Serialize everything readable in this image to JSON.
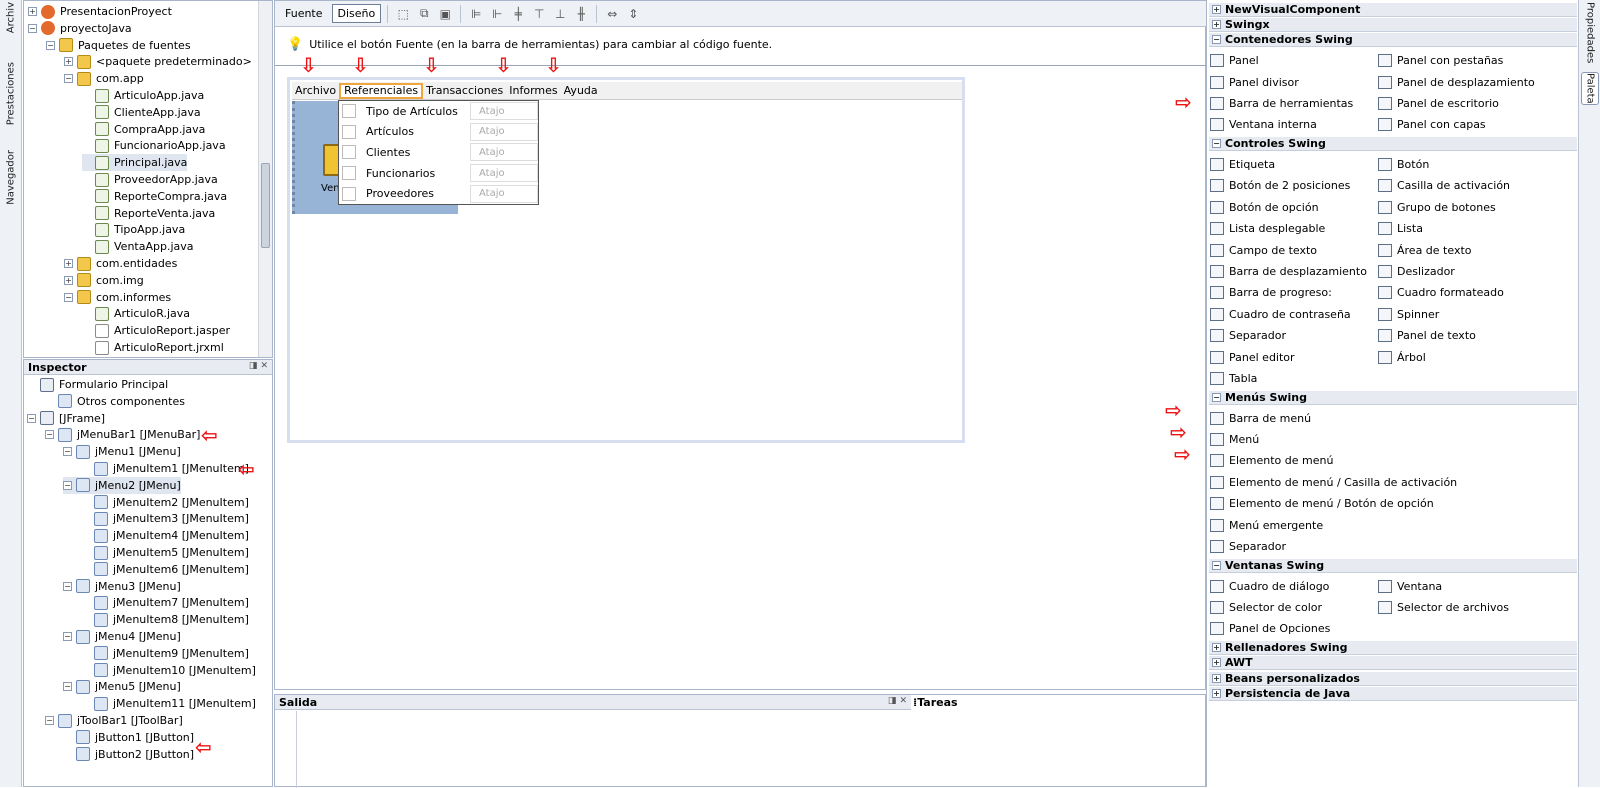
{
  "left_strip": {
    "tabs": [
      "Archiv",
      "Prestaciones",
      "Navegador"
    ]
  },
  "right_strip": {
    "tabs": [
      "Propiedades",
      "Paleta"
    ]
  },
  "projects": {
    "rows": [
      {
        "label": "PresentacionProyect",
        "icon": "project-icon",
        "expander": "+",
        "indent": 0
      },
      {
        "label": "proyectoJava",
        "icon": "project-icon",
        "expander": "−",
        "indent": 0
      },
      {
        "label": "Paquetes de fuentes",
        "icon": "package-folder-icon",
        "expander": "−",
        "indent": 1
      },
      {
        "label": "<paquete predeterminado>",
        "icon": "package-icon",
        "expander": "+",
        "indent": 2
      },
      {
        "label": "com.app",
        "icon": "package-icon",
        "expander": "−",
        "indent": 2
      },
      {
        "label": "ArticuloApp.java",
        "icon": "java-file-icon",
        "expander": "",
        "indent": 3
      },
      {
        "label": "ClienteApp.java",
        "icon": "java-file-icon",
        "expander": "",
        "indent": 3
      },
      {
        "label": "CompraApp.java",
        "icon": "java-file-icon",
        "expander": "",
        "indent": 3
      },
      {
        "label": "FuncionarioApp.java",
        "icon": "java-file-icon",
        "expander": "",
        "indent": 3
      },
      {
        "label": "Principal.java",
        "icon": "java-file-icon",
        "expander": "",
        "indent": 3,
        "selected": true
      },
      {
        "label": "ProveedorApp.java",
        "icon": "java-file-icon",
        "expander": "",
        "indent": 3
      },
      {
        "label": "ReporteCompra.java",
        "icon": "java-file-icon",
        "expander": "",
        "indent": 3
      },
      {
        "label": "ReporteVenta.java",
        "icon": "java-file-icon",
        "expander": "",
        "indent": 3
      },
      {
        "label": "TipoApp.java",
        "icon": "java-file-icon",
        "expander": "",
        "indent": 3
      },
      {
        "label": "VentaApp.java",
        "icon": "java-file-icon",
        "expander": "",
        "indent": 3
      },
      {
        "label": "com.entidades",
        "icon": "package-icon",
        "expander": "+",
        "indent": 2
      },
      {
        "label": "com.img",
        "icon": "package-icon",
        "expander": "+",
        "indent": 2
      },
      {
        "label": "com.informes",
        "icon": "package-icon",
        "expander": "−",
        "indent": 2
      },
      {
        "label": "ArticuloR.java",
        "icon": "java-file-icon",
        "expander": "",
        "indent": 3
      },
      {
        "label": "ArticuloReport.jasper",
        "icon": "file-icon",
        "expander": "",
        "indent": 3
      },
      {
        "label": "ArticuloReport.jrxml",
        "icon": "file-icon",
        "expander": "",
        "indent": 3
      }
    ]
  },
  "inspector": {
    "title": "Inspector",
    "rows": [
      {
        "label": "Formulario Principal",
        "icon": "form-icon",
        "expander": "",
        "indent": 0
      },
      {
        "label": "Otros componentes",
        "icon": "components-icon",
        "expander": "",
        "indent": 1
      },
      {
        "label": "[JFrame]",
        "icon": "frame-icon",
        "expander": "−",
        "indent": 0
      },
      {
        "label": "jMenuBar1 [JMenuBar]",
        "icon": "menubar-icon",
        "expander": "−",
        "indent": 1
      },
      {
        "label": "jMenu1 [JMenu]",
        "icon": "menu-icon",
        "expander": "−",
        "indent": 2
      },
      {
        "label": "jMenuItem1 [JMenuItem]",
        "icon": "menuitem-icon",
        "expander": "",
        "indent": 3
      },
      {
        "label": "jMenu2 [JMenu]",
        "icon": "menu-icon",
        "expander": "−",
        "indent": 2,
        "selected": true
      },
      {
        "label": "jMenuItem2 [JMenuItem]",
        "icon": "menuitem-icon",
        "expander": "",
        "indent": 3
      },
      {
        "label": "jMenuItem3 [JMenuItem]",
        "icon": "menuitem-icon",
        "expander": "",
        "indent": 3
      },
      {
        "label": "jMenuItem4 [JMenuItem]",
        "icon": "menuitem-icon",
        "expander": "",
        "indent": 3
      },
      {
        "label": "jMenuItem5 [JMenuItem]",
        "icon": "menuitem-icon",
        "expander": "",
        "indent": 3
      },
      {
        "label": "jMenuItem6 [JMenuItem]",
        "icon": "menuitem-icon",
        "expander": "",
        "indent": 3
      },
      {
        "label": "jMenu3 [JMenu]",
        "icon": "menu-icon",
        "expander": "−",
        "indent": 2
      },
      {
        "label": "jMenuItem7 [JMenuItem]",
        "icon": "menuitem-icon",
        "expander": "",
        "indent": 3
      },
      {
        "label": "jMenuItem8 [JMenuItem]",
        "icon": "menuitem-icon",
        "expander": "",
        "indent": 3
      },
      {
        "label": "jMenu4 [JMenu]",
        "icon": "menu-icon",
        "expander": "−",
        "indent": 2
      },
      {
        "label": "jMenuItem9 [JMenuItem]",
        "icon": "menuitem-icon",
        "expander": "",
        "indent": 3
      },
      {
        "label": "jMenuItem10 [JMenuItem]",
        "icon": "menuitem-icon",
        "expander": "",
        "indent": 3
      },
      {
        "label": "jMenu5 [JMenu]",
        "icon": "menu-icon",
        "expander": "−",
        "indent": 2
      },
      {
        "label": "jMenuItem11 [JMenuItem]",
        "icon": "menuitem-icon",
        "expander": "",
        "indent": 3
      },
      {
        "label": "jToolBar1 [JToolBar]",
        "icon": "toolbar-icon",
        "expander": "−",
        "indent": 1
      },
      {
        "label": "jButton1 [JButton]",
        "icon": "button-icon",
        "expander": "",
        "indent": 2
      },
      {
        "label": "jButton2 [JButton]",
        "icon": "button-icon",
        "expander": "",
        "indent": 2
      }
    ]
  },
  "design": {
    "tabs": {
      "source": "Fuente",
      "design": "Diseño"
    },
    "hint": "Utilice el botón Fuente (en la barra de herramientas) para cambiar al código fuente.",
    "menubar": [
      "Archivo",
      "Referenciales",
      "Transacciones",
      "Informes",
      "Ayuda"
    ],
    "open_menu": "Referenciales",
    "dropdown": [
      {
        "label": "Tipo de Artículos",
        "accel": "Atajo"
      },
      {
        "label": "Artículos",
        "accel": "Atajo"
      },
      {
        "label": "Clientes",
        "accel": "Atajo"
      },
      {
        "label": "Funcionarios",
        "accel": "Atajo"
      },
      {
        "label": "Proveedores",
        "accel": "Atajo"
      }
    ],
    "toolbar_button_label": "Ven"
  },
  "output": {
    "salida": "Salida",
    "tareas": "Tareas"
  },
  "palette": {
    "categories": [
      {
        "name": "NewVisualComponent",
        "expanded": false,
        "items": []
      },
      {
        "name": "Swingx",
        "expanded": false,
        "items": []
      },
      {
        "name": "Contenedores Swing",
        "expanded": true,
        "items": [
          {
            "label": "Panel",
            "icon": "panel-icon"
          },
          {
            "label": "Panel con pestañas",
            "icon": "tabbed-panel-icon"
          },
          {
            "label": "Panel divisor",
            "icon": "split-panel-icon"
          },
          {
            "label": "Panel de desplazamiento",
            "icon": "scroll-panel-icon"
          },
          {
            "label": "Barra de herramientas",
            "icon": "toolbar-icon"
          },
          {
            "label": "Panel de escritorio",
            "icon": "desktop-panel-icon"
          },
          {
            "label": "Ventana interna",
            "icon": "internal-frame-icon"
          },
          {
            "label": "Panel con capas",
            "icon": "layered-panel-icon"
          }
        ]
      },
      {
        "name": "Controles Swing",
        "expanded": true,
        "items": [
          {
            "label": "Etiqueta",
            "icon": "label-icon"
          },
          {
            "label": "Botón",
            "icon": "button-icon"
          },
          {
            "label": "Botón de 2 posiciones",
            "icon": "toggle-button-icon"
          },
          {
            "label": "Casilla de activación",
            "icon": "checkbox-icon"
          },
          {
            "label": "Botón de opción",
            "icon": "radio-icon"
          },
          {
            "label": "Grupo de botones",
            "icon": "button-group-icon"
          },
          {
            "label": "Lista desplegable",
            "icon": "combobox-icon"
          },
          {
            "label": "Lista",
            "icon": "list-icon"
          },
          {
            "label": "Campo de texto",
            "icon": "textfield-icon"
          },
          {
            "label": "Área de texto",
            "icon": "textarea-icon"
          },
          {
            "label": "Barra de desplazamiento",
            "icon": "scrollbar-icon"
          },
          {
            "label": "Deslizador",
            "icon": "slider-icon"
          },
          {
            "label": "Barra de progreso:",
            "icon": "progressbar-icon"
          },
          {
            "label": "Cuadro formateado",
            "icon": "formatted-field-icon"
          },
          {
            "label": "Cuadro de contraseña",
            "icon": "password-icon"
          },
          {
            "label": "Spinner",
            "icon": "spinner-icon"
          },
          {
            "label": "Separador",
            "icon": "separator-icon"
          },
          {
            "label": "Panel de texto",
            "icon": "textpane-icon"
          },
          {
            "label": "Panel editor",
            "icon": "editorpane-icon"
          },
          {
            "label": "Árbol",
            "icon": "tree-icon"
          },
          {
            "label": "Tabla",
            "icon": "table-icon"
          }
        ]
      },
      {
        "name": "Menús Swing",
        "expanded": true,
        "single_column": true,
        "items": [
          {
            "label": "Barra de menú",
            "icon": "menubar-icon"
          },
          {
            "label": "Menú",
            "icon": "menu-icon"
          },
          {
            "label": "Elemento de menú",
            "icon": "menuitem-icon"
          },
          {
            "label": "Elemento de menú / Casilla de activación",
            "icon": "checkbox-menuitem-icon"
          },
          {
            "label": "Elemento de menú / Botón de opción",
            "icon": "radio-menuitem-icon"
          },
          {
            "label": "Menú emergente",
            "icon": "popup-menu-icon"
          },
          {
            "label": "Separador",
            "icon": "separator-icon"
          }
        ]
      },
      {
        "name": "Ventanas Swing",
        "expanded": true,
        "items": [
          {
            "label": "Cuadro de diálogo",
            "icon": "dialog-icon"
          },
          {
            "label": "Ventana",
            "icon": "frame-icon"
          },
          {
            "label": "Selector de color",
            "icon": "color-chooser-icon"
          },
          {
            "label": "Selector de archivos",
            "icon": "file-chooser-icon"
          },
          {
            "label": "Panel de Opciones",
            "icon": "option-pane-icon"
          }
        ]
      },
      {
        "name": "Rellenadores Swing",
        "expanded": false,
        "items": []
      },
      {
        "name": "AWT",
        "expanded": false,
        "items": []
      },
      {
        "name": "Beans personalizados",
        "expanded": false,
        "items": []
      },
      {
        "name": "Persistencia de Java",
        "expanded": false,
        "items": []
      }
    ]
  },
  "colors": {
    "accent_arrow": "#e11111",
    "selection": "#dfe6f0",
    "toolbar_blue": "#97b4d6",
    "open_menu_border": "#f0a63f"
  }
}
